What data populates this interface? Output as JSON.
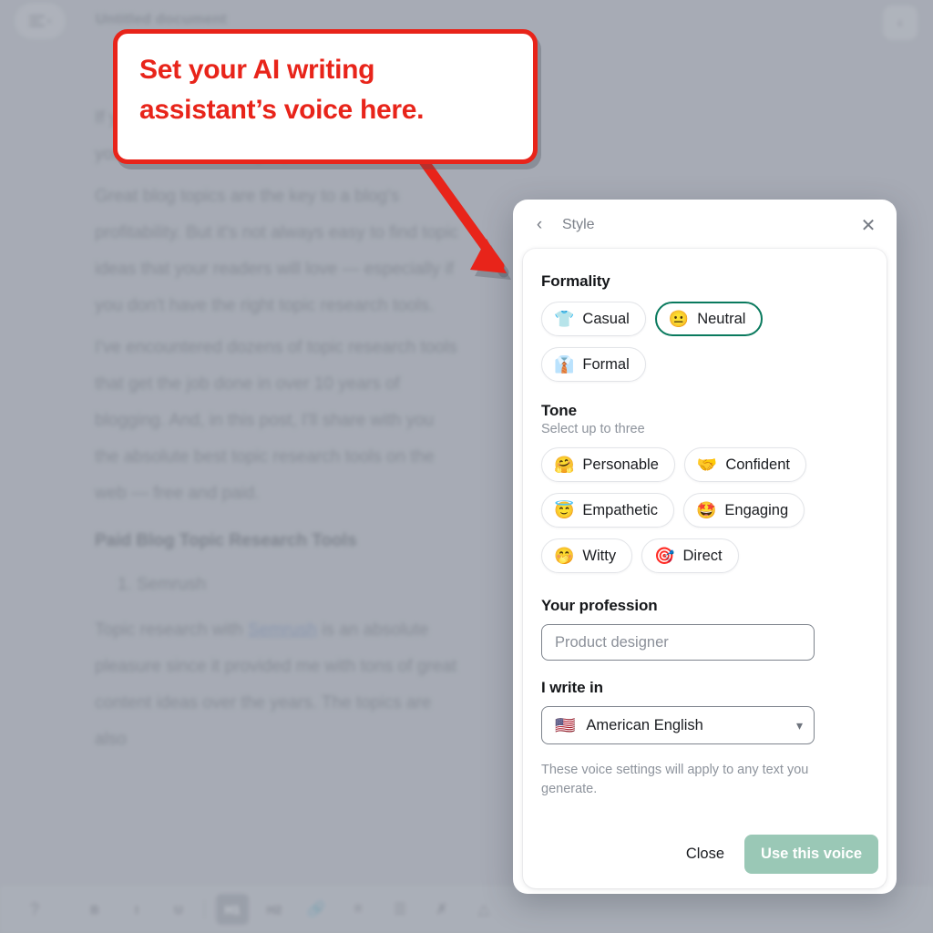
{
  "app": {
    "document_title": "Untitled document",
    "menu_icon": "hamburger-menu-icon",
    "collapse_icon": "chevron-left-icon"
  },
  "document": {
    "paragraphs": [
      "If you're a blogger looking for blog topic ideas, you've come to the right place.",
      "Great blog topics are the key to a blog's profitability. But it's not always easy to find topic ideas that your readers will love — especially if you don't have the right topic research tools.",
      "I've encountered dozens of topic research tools that get the job done in over 10 years of blogging. And, in this post, I'll share with you the absolute best topic research tools on the web — free and paid."
    ],
    "heading": "Paid Blog Topic Research Tools",
    "list_items": [
      "Semrush"
    ],
    "last_paragraph_before_link": "Topic research with ",
    "link_text": "Semrush",
    "last_paragraph_after_link": " is an absolute pleasure since it provided me with tons of great content ideas over the years. The topics are also"
  },
  "toolbar": {
    "items": [
      {
        "name": "help-icon",
        "glyph": "?"
      },
      {
        "name": "bold-button",
        "glyph": "B"
      },
      {
        "name": "italic-button",
        "glyph": "I"
      },
      {
        "name": "underline-button",
        "glyph": "U"
      },
      {
        "name": "heading-1-button",
        "glyph": "H1"
      },
      {
        "name": "heading-2-button",
        "glyph": "H2"
      },
      {
        "name": "link-button",
        "glyph": "🔗"
      },
      {
        "name": "ordered-list-button",
        "glyph": "≡"
      },
      {
        "name": "bullet-list-button",
        "glyph": "☰"
      },
      {
        "name": "clear-format-button",
        "glyph": "✗"
      },
      {
        "name": "highlight-button",
        "glyph": "△"
      }
    ]
  },
  "callout": {
    "text": "Set your AI writing assistant’s voice here.",
    "color": "#e8241a"
  },
  "panel": {
    "header": {
      "back_icon": "chevron-left-icon",
      "title": "Style",
      "close_icon": "close-x-icon"
    },
    "formality": {
      "title": "Formality",
      "options": [
        {
          "label": "Casual",
          "emoji": "👕",
          "selected": false
        },
        {
          "label": "Neutral",
          "emoji": "😐",
          "selected": true
        },
        {
          "label": "Formal",
          "emoji": "👔",
          "selected": false
        }
      ]
    },
    "tone": {
      "title": "Tone",
      "subtitle": "Select up to three",
      "options": [
        {
          "label": "Personable",
          "emoji": "🤗",
          "selected": false
        },
        {
          "label": "Confident",
          "emoji": "🤝",
          "selected": false
        },
        {
          "label": "Empathetic",
          "emoji": "😇",
          "selected": false
        },
        {
          "label": "Engaging",
          "emoji": "🤩",
          "selected": false
        },
        {
          "label": "Witty",
          "emoji": "🤭",
          "selected": false
        },
        {
          "label": "Direct",
          "emoji": "🎯",
          "selected": false
        }
      ]
    },
    "profession": {
      "title": "Your profession",
      "placeholder": "Product designer",
      "value": ""
    },
    "language": {
      "title": "I write in",
      "selected": "American English",
      "flag": "🇺🇸",
      "chevron": "⌄"
    },
    "note": "These voice settings will apply to any text you generate.",
    "actions": {
      "close_label": "Close",
      "primary_label": "Use this voice",
      "primary_color": "#9ac8b6",
      "primary_disabled": true
    }
  },
  "colors": {
    "background": "#b4b9c1",
    "accent_green": "#0a7a5e",
    "callout_red": "#e8241a"
  }
}
